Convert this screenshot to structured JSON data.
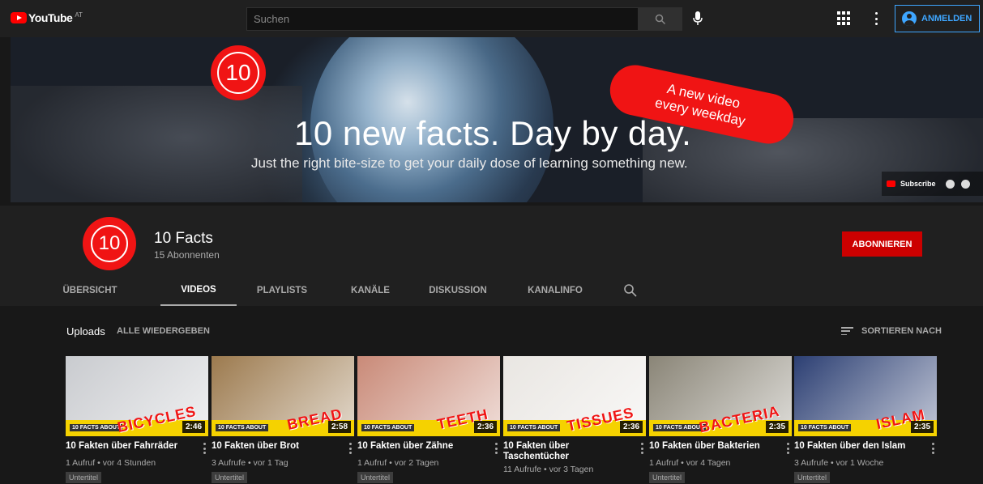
{
  "topbar": {
    "logo_text": "YouTube",
    "region": "AT",
    "search_placeholder": "Suchen",
    "signin_label": "ANMELDEN"
  },
  "banner": {
    "logo_text": "10",
    "pill_line1": "A new video",
    "pill_line2": "every weekday",
    "headline": "10 new facts. Day by day.",
    "subline": "Just the right bite-size to get your daily dose of learning something new.",
    "subscribe_link": "Subscribe"
  },
  "channel": {
    "avatar_text": "10",
    "name": "10 Facts",
    "subscribers": "15 Abonnenten",
    "subscribe_label": "ABONNIEREN"
  },
  "tabs": [
    {
      "label": "ÜBERSICHT",
      "active": false
    },
    {
      "label": "VIDEOS",
      "active": true
    },
    {
      "label": "PLAYLISTS",
      "active": false
    },
    {
      "label": "KANÄLE",
      "active": false
    },
    {
      "label": "DISKUSSION",
      "active": false
    },
    {
      "label": "KANALINFO",
      "active": false
    }
  ],
  "uploads": {
    "title": "Uploads",
    "play_all": "ALLE WIEDERGEBEN",
    "sort_label": "SORTIEREN NACH"
  },
  "videos": [
    {
      "title": "10 Fakten über Fahrräder",
      "meta": "1 Aufruf • vor 4 Stunden",
      "duration": "2:46",
      "badge": "Untertitel",
      "thumb_word": "BICYCLES",
      "thumb_badge": "10 FACTS ABOUT",
      "thumb_color": "#c9cbcf"
    },
    {
      "title": "10 Fakten über Brot",
      "meta": "3 Aufrufe • vor 1 Tag",
      "duration": "2:58",
      "badge": "Untertitel",
      "thumb_word": "BREAD",
      "thumb_badge": "10 FACTS ABOUT",
      "thumb_color": "#9c7a4e"
    },
    {
      "title": "10 Fakten über Zähne",
      "meta": "1 Aufruf • vor 2 Tagen",
      "duration": "2:36",
      "badge": "Untertitel",
      "thumb_word": "TEETH",
      "thumb_badge": "10 FACTS ABOUT",
      "thumb_color": "#c98a78"
    },
    {
      "title": "10 Fakten über Taschentücher",
      "meta": "11 Aufrufe • vor 3 Tagen",
      "duration": "2:36",
      "badge": "",
      "thumb_word": "TISSUES",
      "thumb_badge": "10 FACTS ABOUT",
      "thumb_color": "#e9e6e2"
    },
    {
      "title": "10 Fakten über Bakterien",
      "meta": "1 Aufruf • vor 4 Tagen",
      "duration": "2:35",
      "badge": "Untertitel",
      "thumb_word": "BACTERIA",
      "thumb_badge": "10 FACTS ABOUT",
      "thumb_color": "#8a8577"
    },
    {
      "title": "10 Fakten über den Islam",
      "meta": "3 Aufrufe • vor 1 Woche",
      "duration": "2:35",
      "badge": "Untertitel",
      "thumb_word": "ISLAM",
      "thumb_badge": "10 FACTS ABOUT",
      "thumb_color": "#2c3f73"
    }
  ]
}
